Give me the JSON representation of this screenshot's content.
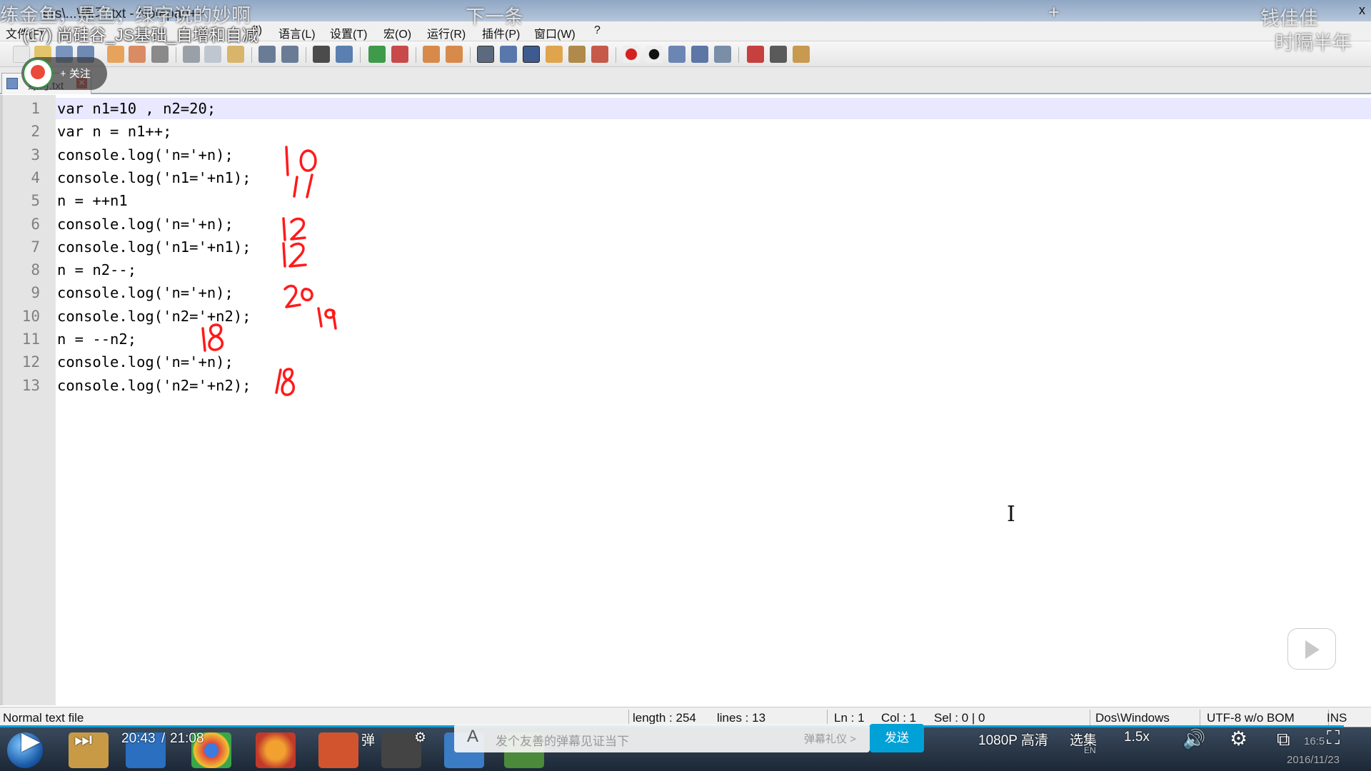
{
  "window": {
    "title": "ers\\...\\练习.txt - Notepad++",
    "close_glyph": "x"
  },
  "menu": [
    {
      "label": "文件(F)"
    },
    {
      "label": "(I)"
    },
    {
      "label": "语言(L)"
    },
    {
      "label": "设置(T)"
    },
    {
      "label": "宏(O)"
    },
    {
      "label": "运行(R)"
    },
    {
      "label": "插件(P)"
    },
    {
      "label": "窗口(W)"
    },
    {
      "label": "?"
    }
  ],
  "tab": {
    "label": "练习.txt",
    "close_glyph": "✕"
  },
  "editor": {
    "current_line": 1,
    "lines": [
      "var n1=10 , n2=20;",
      "var n = n1++;",
      "console.log('n='+n);",
      "console.log('n1='+n1);",
      "n = ++n1",
      "console.log('n='+n);",
      "console.log('n1='+n1);",
      "n = n2--;",
      "console.log('n='+n);",
      "console.log('n2='+n2);",
      "n = --n2;",
      "console.log('n='+n);",
      "console.log('n2='+n2);"
    ],
    "line_numbers": [
      "1",
      "2",
      "3",
      "4",
      "5",
      "6",
      "7",
      "8",
      "9",
      "10",
      "11",
      "12",
      "13"
    ]
  },
  "annotations": [
    "10",
    "11",
    "12",
    "12",
    "20",
    "19",
    "18",
    "18"
  ],
  "status": {
    "file_type": "Normal text file",
    "length": "length : 254",
    "lines": "lines : 13",
    "ln": "Ln : 1",
    "col": "Col : 1",
    "sel": "Sel : 0 | 0",
    "eol": "Dos\\Windows",
    "encoding": "UTF-8 w/o BOM",
    "mode": "INS"
  },
  "video": {
    "title": "(17) 尚硅谷_JS基础_自增和自减",
    "danmaku": [
      "练金鱼，是鱼，绿字说的妙啊",
      "下一条",
      "钱佳佳",
      "时隔半年",
      "+"
    ],
    "follow_label": "+ 关注",
    "time_current": "20:43",
    "time_total": "21:08",
    "progress": 0.98,
    "danmaku_placeholder": "发个友善的弹幕见证当下",
    "danmaku_etiquette": "弹幕礼仪 >",
    "send_label": "发送",
    "quality_label": "1080P 高清",
    "episodes_label": "选集",
    "speed_label": "1.5x",
    "danmaku_toggle_label": "弹"
  },
  "taskbar": {
    "clock_time": "16:5",
    "clock_date": "2016/11/23",
    "lang": "EN"
  },
  "colors": {
    "accent_blue": "#00a1d6",
    "ink_red": "#ff1a1a",
    "current_line": "#e8e8ff"
  }
}
